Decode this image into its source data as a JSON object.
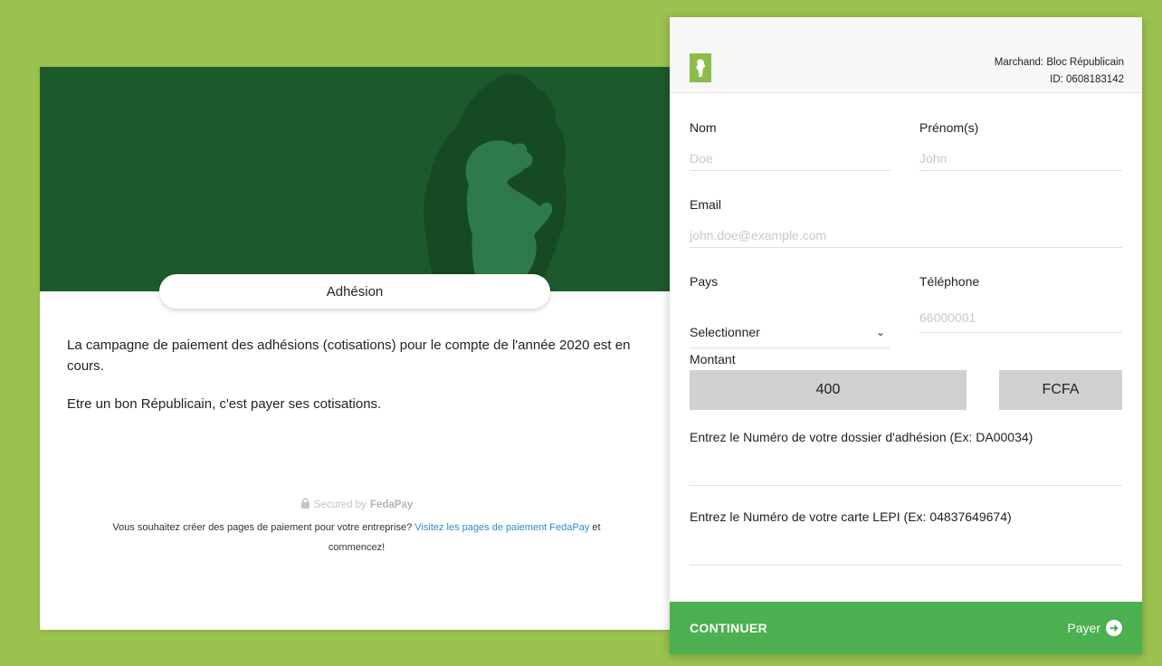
{
  "campaign": {
    "pill_title": "Adhésion",
    "description_1": "La campagne de paiement des adhésions (cotisations) pour le compte de l'année 2020 est en cours.",
    "description_2": "Etre un bon Républicain, c'est payer ses cotisations.",
    "secured_prefix": "Secured by",
    "secured_brand": "FedaPay",
    "footer_text_1": "Vous souhaitez créer des pages de paiement pour votre entreprise?",
    "footer_link": "Visitez les pages de paiement FedaPay",
    "footer_text_2": "et commencez!"
  },
  "merchant": {
    "name": "Marchand: Bloc Républicain",
    "id": "ID: 0608183142"
  },
  "form": {
    "nom_label": "Nom",
    "nom_placeholder": "Doe",
    "prenom_label": "Prénom(s)",
    "prenom_placeholder": "John",
    "email_label": "Email",
    "email_placeholder": "john.doe@example.com",
    "pays_label": "Pays",
    "pays_value": "Selectionner",
    "telephone_label": "Téléphone",
    "telephone_placeholder": "66000001",
    "montant_label": "Montant",
    "montant_value": "400",
    "currency": "FCFA",
    "dossier_label": "Entrez le Numéro de votre dossier d'adhésion (Ex: DA00034)",
    "lepi_label": "Entrez le Numéro de votre carte LEPI (Ex: 04837649674)"
  },
  "actions": {
    "continue_label": "CONTINUER",
    "pay_label": "Payer"
  },
  "colors": {
    "page_bg": "#9bc24f",
    "banner_bg": "#1c5a2c",
    "footer_bg": "#4caf50",
    "link": "#2b8ccb"
  }
}
